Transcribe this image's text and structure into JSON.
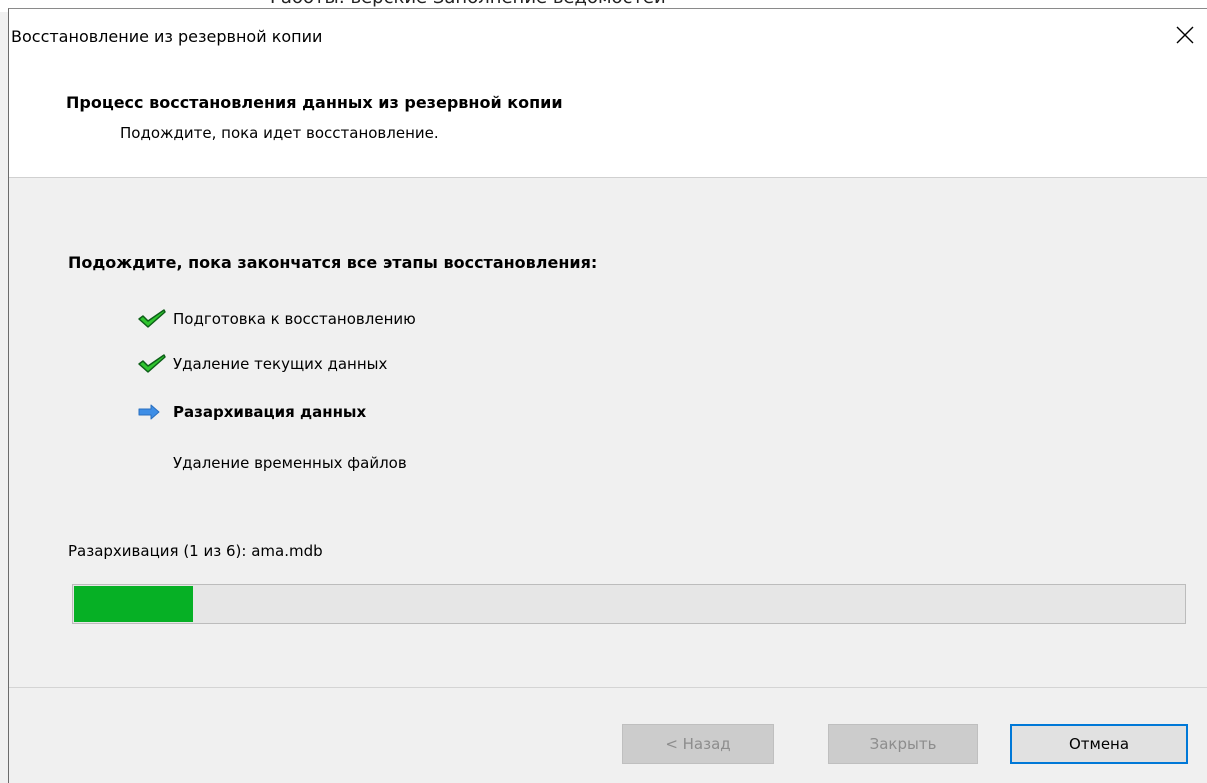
{
  "background_window": {
    "partial_title": "Работы: верские Заполнение ведомостей"
  },
  "dialog": {
    "title": "Восстановление из резервной копии",
    "close_icon": "close-icon"
  },
  "header": {
    "title": "Процесс восстановления данных из резервной копии",
    "subtitle": "Подождите, пока идет восстановление."
  },
  "content": {
    "title": "Подождите, пока закончатся все этапы восстановления:",
    "steps": [
      {
        "label": "Подготовка к восстановлению",
        "state": "done",
        "icon": "checkmark-icon"
      },
      {
        "label": "Удаление текущих данных",
        "state": "done",
        "icon": "checkmark-icon"
      },
      {
        "label": "Разархивация данных",
        "state": "current",
        "icon": "arrow-right-icon"
      },
      {
        "label": "Удаление временных файлов",
        "state": "pending",
        "icon": ""
      }
    ],
    "status": "Разархивация (1 из 6): ama.mdb",
    "progress_fraction": 0.107
  },
  "buttons": {
    "back_label": "< Назад",
    "close_label": "Закрыть",
    "cancel_label": "Отмена"
  },
  "colors": {
    "progress_fill": "#06b025",
    "checkmark": "#2fc52f",
    "arrow": "#3e8ee6",
    "default_button_border": "#0078d7"
  }
}
